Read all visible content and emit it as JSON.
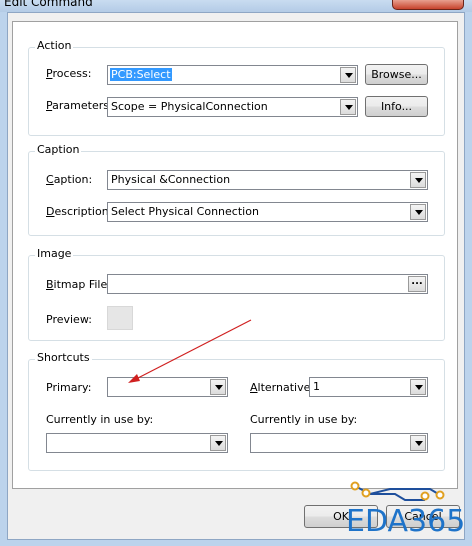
{
  "window": {
    "title": "Edit Command"
  },
  "action": {
    "title": "Action",
    "process_label": "Process:",
    "process_value": "PCB:Select",
    "browse_label": "Browse...",
    "parameters_label": "Parameters:",
    "parameters_value": "Scope = PhysicalConnection",
    "info_label": "Info..."
  },
  "caption": {
    "title": "Caption",
    "caption_label": "Caption:",
    "caption_value": "Physical &Connection",
    "description_label": "Description:",
    "description_value": "Select Physical Connection"
  },
  "image": {
    "title": "Image",
    "bitmap_label": "Bitmap File:",
    "bitmap_value": "",
    "ellipsis": "...",
    "preview_label": "Preview:"
  },
  "shortcuts": {
    "title": "Shortcuts",
    "primary_label": "Primary:",
    "primary_value": "",
    "alternative_label": "Alternative:",
    "alternative_value": "1",
    "in_use_label_1": "Currently in use by:",
    "in_use_label_2": "Currently in use by:"
  },
  "buttons": {
    "ok": "OK",
    "cancel": "Cancel"
  },
  "watermark": {
    "text": "EDA365"
  },
  "colors": {
    "annotation_arrow": "#d02020",
    "watermark": "#1e73c9",
    "selection": "#3399ff"
  }
}
